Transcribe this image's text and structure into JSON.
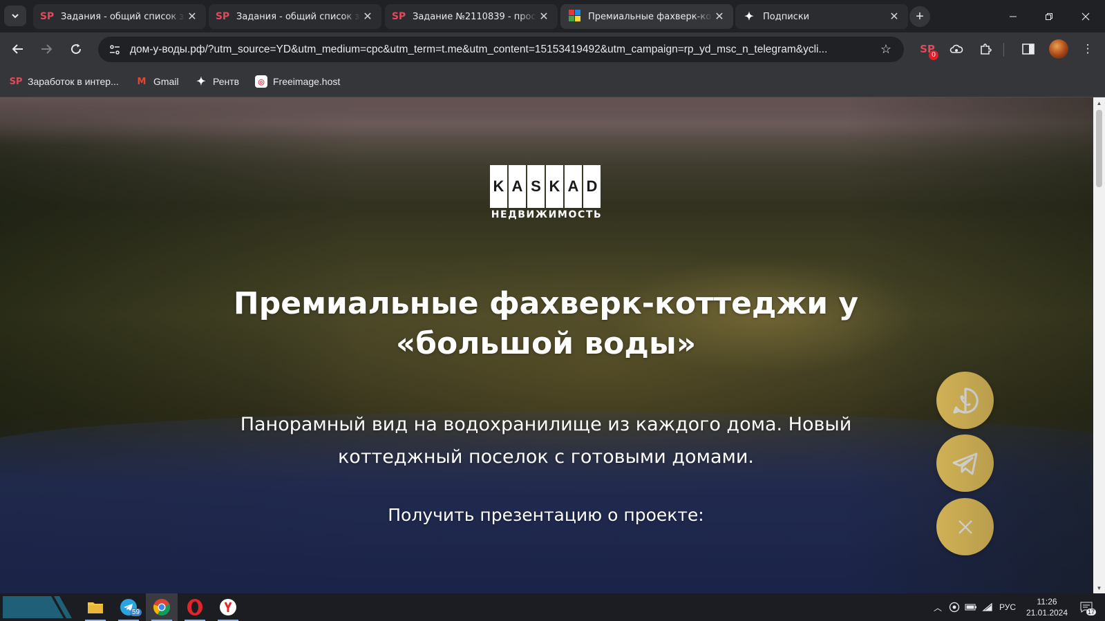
{
  "browser": {
    "tabs": [
      {
        "title": "Задания - общий список за",
        "favicon": "sp-icon",
        "active": false
      },
      {
        "title": "Задания - общий список за",
        "favicon": "sp-icon",
        "active": false
      },
      {
        "title": "Задание №2110839 - прос",
        "favicon": "sp-icon",
        "active": false
      },
      {
        "title": "Премиальные фахверк-кот",
        "favicon": "colored-squares-icon",
        "active": true
      },
      {
        "title": "Подписки",
        "favicon": "star-icon",
        "active": false
      }
    ],
    "address": "дом-у-воды.рф/?utm_source=YD&utm_medium=cpc&utm_term=t.me&utm_content=15153419492&utm_campaign=rp_yd_msc_n_telegram&ycli...",
    "extension_badge": "0",
    "bookmarks": [
      {
        "label": "Заработок в интер..."
      },
      {
        "label": "Gmail"
      },
      {
        "label": "Рентв"
      },
      {
        "label": "Freeimage.host"
      }
    ]
  },
  "page": {
    "logo_letters": [
      "K",
      "A",
      "S",
      "K",
      "A",
      "D"
    ],
    "logo_sub": "НЕДВИЖИМОСТЬ",
    "title": "Премиальные фахверк-коттеджи у «большой воды»",
    "subtitle": "Панорамный вид на водохранилище из каждого дома. Новый коттеджный поселок с готовыми домами.",
    "cta": "Получить презентацию о проекте:",
    "accent_color": "#f6cf63"
  },
  "taskbar": {
    "telegram_badge": "59",
    "language": "РУС",
    "time": "11:26",
    "date": "21.01.2024",
    "notifications": "17"
  }
}
